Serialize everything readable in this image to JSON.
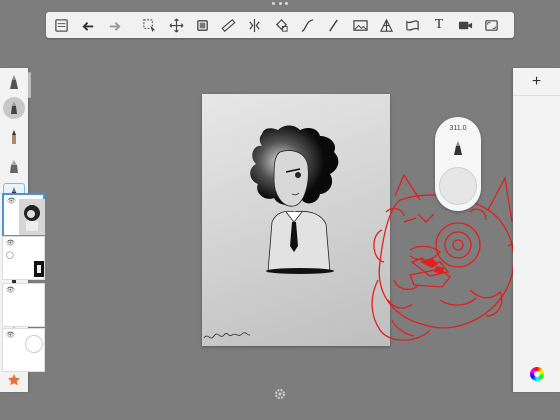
{
  "toolbar": {
    "icons": [
      "gallery-icon",
      "undo-icon",
      "redo-icon",
      "select-icon",
      "transform-icon",
      "crop-icon",
      "ruler-icon",
      "symmetry-icon",
      "fill-icon",
      "curve-icon",
      "stroke-icon",
      "image-icon",
      "perspective-icon",
      "distort-icon",
      "text-icon",
      "video-icon",
      "fullscreen-icon"
    ],
    "text_glyph": "T"
  },
  "brush_puck": {
    "size_label": "311.0"
  },
  "layers": {
    "add_label": "+"
  },
  "colors": {
    "accent": "#4b94d8",
    "scribble": "#e0201c",
    "panel": "#f3f3f3",
    "background": "#7d7d7d"
  }
}
